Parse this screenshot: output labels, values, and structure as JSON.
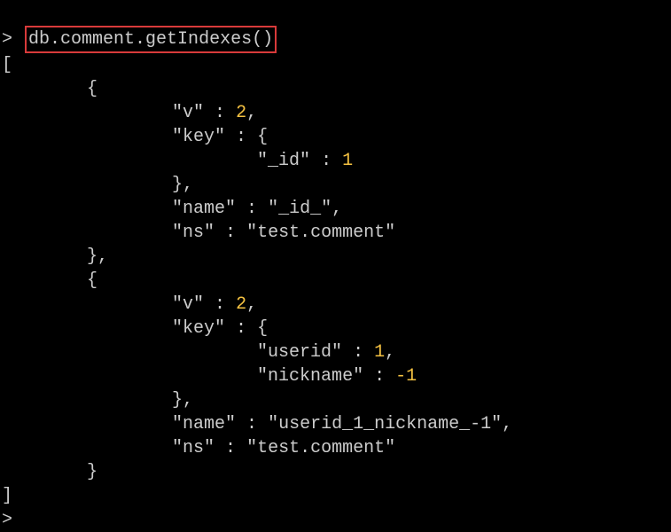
{
  "prompt1": ">",
  "command": "db.comment.getIndexes()",
  "output": {
    "arr_open": "[",
    "idx0": {
      "obj_open": "{",
      "v_key": "\"v\"",
      "v_val": "2",
      "key_key": "\"key\"",
      "key_open": "{",
      "id_key": "\"_id\"",
      "id_val": "1",
      "key_close": "}",
      "name_key": "\"name\"",
      "name_val": "\"_id_\"",
      "ns_key": "\"ns\"",
      "ns_val": "\"test.comment\"",
      "obj_close": "}"
    },
    "idx1": {
      "obj_open": "{",
      "v_key": "\"v\"",
      "v_val": "2",
      "key_key": "\"key\"",
      "key_open": "{",
      "userid_key": "\"userid\"",
      "userid_val": "1",
      "nickname_key": "\"nickname\"",
      "nickname_val": "-1",
      "key_close": "}",
      "name_key": "\"name\"",
      "name_val": "\"userid_1_nickname_-1\"",
      "ns_key": "\"ns\"",
      "ns_val": "\"test.comment\"",
      "obj_close": "}"
    },
    "arr_close": "]"
  },
  "prompt2": ">"
}
